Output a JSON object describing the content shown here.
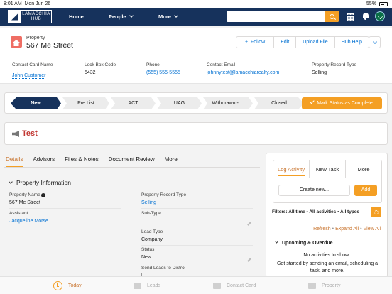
{
  "status_bar": {
    "time": "8:01 AM",
    "date": "Mon Jun 26",
    "battery": "55%"
  },
  "navbar": {
    "logo_text_top": "LAMACCHIA",
    "logo_text_bottom": "HUB",
    "items": [
      {
        "label": "Home"
      },
      {
        "label": "People"
      },
      {
        "label": "More"
      }
    ],
    "search_value": "",
    "accent": "#f49f24",
    "bg": "#16325c"
  },
  "record": {
    "object_label": "Property",
    "title": "567 Me Street",
    "actions": [
      "Follow",
      "Edit",
      "Upload File",
      "Hub Help"
    ],
    "follow_prefix": "+",
    "fields": [
      {
        "label": "Contact Card Name",
        "value": "John Customer"
      },
      {
        "label": "Lock Box Code",
        "value": "5432"
      },
      {
        "label": "Phone",
        "value": "(555) 555-5555"
      },
      {
        "label": "Contact Email",
        "value": "johnnytest@lamacchiarealty.com"
      },
      {
        "label": "Property Record Type",
        "value": "Selling"
      }
    ]
  },
  "path": {
    "stages": [
      "New",
      "Pre List",
      "ACT",
      "UAG",
      "Withdrawn - ...",
      "Closed"
    ],
    "active_index": 0,
    "mark_button": "Mark Status as Complete"
  },
  "alert": {
    "title": "Test"
  },
  "tabs": [
    "Details",
    "Advisors",
    "Files & Notes",
    "Document Review",
    "More"
  ],
  "details": {
    "section_title": "Property Information",
    "left": [
      {
        "label": "Property Name",
        "value": "567 Me Street"
      },
      {
        "label": "Assistant",
        "value": "Jacqueline Morse"
      }
    ],
    "right": [
      {
        "label": "Property Record Type",
        "value": "Selling"
      },
      {
        "label": "Sub-Type",
        "value": ""
      },
      {
        "label": "Lead Type",
        "value": "Company"
      },
      {
        "label": "Status",
        "value": "New"
      },
      {
        "label": "Send Leads to Distro",
        "value": ""
      }
    ]
  },
  "activity": {
    "tabs": [
      "Log Activity",
      "New Task",
      "More"
    ],
    "create_placeholder": "Create new...",
    "add_button": "Add",
    "filters": "Filters: All time • All activities • All types",
    "links": [
      "Refresh",
      "Expand All",
      "View All"
    ],
    "upcoming_title": "Upcoming & Overdue",
    "empty_title": "No activities to show.",
    "empty_body": "Get started by sending an email, scheduling a task, and more."
  },
  "bottom_nav": [
    {
      "label": "Today",
      "icon": "clock-icon"
    },
    {
      "label": "Leads",
      "icon": "leads-icon"
    },
    {
      "label": "Contact Card",
      "icon": "contact-card-icon"
    },
    {
      "label": "Property",
      "icon": "property-icon"
    }
  ]
}
